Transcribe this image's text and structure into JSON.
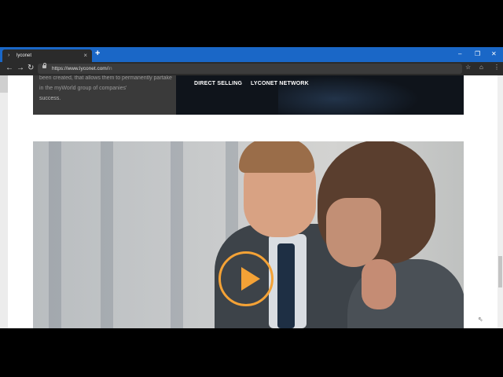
{
  "browser": {
    "tab": {
      "title": "lyconet",
      "close": "×"
    },
    "newtab": "+",
    "window": {
      "minimize": "–",
      "maximize": "❐",
      "close": "✕"
    },
    "url": {
      "domain": "https://www.lyconet.com/",
      "path": "in"
    },
    "colors": {
      "tabstrip": "#1a67c7",
      "toolbar": "#2b2b2b"
    }
  },
  "page": {
    "intro_text": "been created, that allows them to permanently partake in the myWorld group of companies'",
    "intro_text_end": "success.",
    "nav": {
      "direct_selling": "DIRECT SELLING",
      "lyconet_network": "LYCONET NETWORK"
    },
    "accent_color": "#f4a236"
  }
}
